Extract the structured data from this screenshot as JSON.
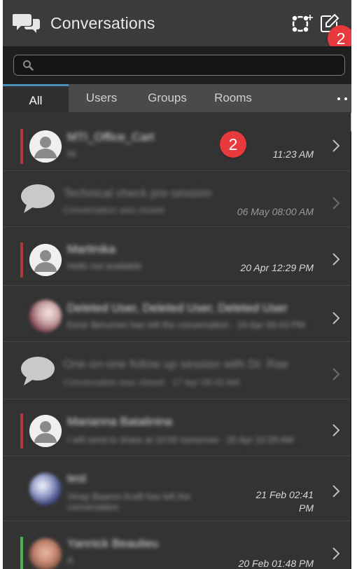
{
  "header": {
    "title": "Conversations",
    "app_icon": "chat-bubbles-icon",
    "conference_icon": "conference-add-icon",
    "compose_icon": "compose-icon",
    "notification_badge": "2"
  },
  "search": {
    "placeholder": "",
    "value": ""
  },
  "tabs": [
    {
      "label": "All",
      "active": true
    },
    {
      "label": "Users",
      "active": false
    },
    {
      "label": "Groups",
      "active": false
    },
    {
      "label": "Rooms",
      "active": false
    }
  ],
  "list_badge": "2",
  "conversations": [
    {
      "title": "MTI_Office_Cart",
      "subtitle": "Hi",
      "time": "11:23 AM",
      "type": "user",
      "status": "red"
    },
    {
      "title": "Technical check pre-session",
      "subtitle": "Conversation was closed",
      "time": "06 May 08:00 AM",
      "type": "room",
      "status": "none"
    },
    {
      "title": "Martinika",
      "subtitle": "Hello not available",
      "time": "20 Apr 12:29 PM",
      "type": "user",
      "status": "red"
    },
    {
      "title": "Deleted User, Deleted User, Deleted User",
      "subtitle": "Einar Berumen has left the conversation · 19 Apr 09:43 PM",
      "time": "",
      "type": "photo",
      "status": "none"
    },
    {
      "title": "One-on-one follow up session with Dr. Rae",
      "subtitle": "Conversation was closed · 17 Apr 09:43 AM",
      "time": "",
      "type": "room",
      "status": "none"
    },
    {
      "title": "Marianna Batalinina",
      "subtitle": "I will send to share at 10:00 tomorrow · 20 Apr 10:29 AM",
      "time": "",
      "type": "user",
      "status": "red"
    },
    {
      "title": "test",
      "subtitle": "Vinay Baaron Kraft has left the conversation",
      "time": "21 Feb 02:41 PM",
      "type": "photo",
      "status": "none"
    },
    {
      "title": "Yannick Beaulieu",
      "subtitle": "A",
      "time": "20 Feb 01:48 PM",
      "type": "photo",
      "status": "green"
    }
  ],
  "colors": {
    "badge": "#e8393c",
    "tab_active_accent": "#4a90b8",
    "status_busy": "#b03a3a",
    "status_available": "#4cb050"
  }
}
